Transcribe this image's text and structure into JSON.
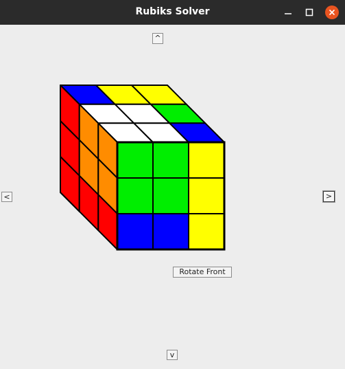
{
  "window": {
    "title": "Rubiks Solver",
    "controls": [
      "minimize-icon",
      "maximize-icon",
      "close-icon"
    ]
  },
  "buttons": {
    "up": "^",
    "left": "<",
    "right": ">",
    "down": "v",
    "rotate_front": "Rotate Front"
  },
  "cube": {
    "colors": {
      "R": "#ff0000",
      "O": "#ff8c00",
      "Y": "#ffff00",
      "G": "#00ee00",
      "B": "#0000ff",
      "W": "#ffffff"
    },
    "top": [
      [
        "B",
        "Y",
        "Y"
      ],
      [
        "W",
        "W",
        "G"
      ],
      [
        "W",
        "W",
        "B"
      ]
    ],
    "left_outer": [
      [
        "R"
      ],
      [
        "R"
      ],
      [
        "R"
      ]
    ],
    "left": [
      [
        "R",
        "O",
        "O"
      ],
      [
        "R",
        "O",
        "O"
      ],
      [
        "R",
        "R",
        "R"
      ]
    ],
    "front": [
      [
        "G",
        "G",
        "Y"
      ],
      [
        "G",
        "G",
        "Y"
      ],
      [
        "B",
        "B",
        "Y"
      ]
    ]
  }
}
